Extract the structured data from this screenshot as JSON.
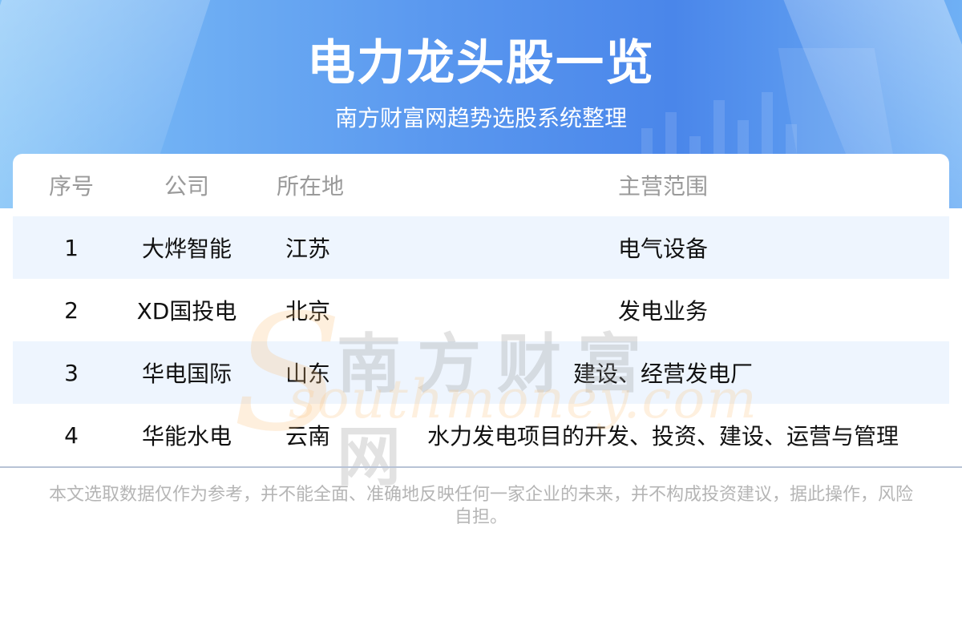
{
  "header": {
    "title": "电力龙头股一览",
    "subtitle": "南方财富网趋势选股系统整理"
  },
  "table": {
    "columns": [
      "序号",
      "公司",
      "所在地",
      "主营范围"
    ],
    "rows": [
      {
        "index": "1",
        "company": "大烨智能",
        "location": "江苏",
        "business": "电气设备"
      },
      {
        "index": "2",
        "company": "XD国投电",
        "location": "北京",
        "business": "发电业务"
      },
      {
        "index": "3",
        "company": "华电国际",
        "location": "山东",
        "business": "建设、经营发电厂"
      },
      {
        "index": "4",
        "company": "华能水电",
        "location": "云南",
        "business": "水力发电项目的开发、投资、建设、运营与管理"
      }
    ]
  },
  "watermark": {
    "cn": "南方财富网",
    "en": "southmoney.com"
  },
  "footer": {
    "disclaimer": "本文选取数据仅作为参考，并不能全面、准确地反映任何一家企业的未来，并不构成投资建议，据此操作，风险自担。"
  },
  "colors": {
    "header_gradient_start": "#7fc1f7",
    "header_gradient_mid": "#4a86ea",
    "row_alt": "#eef5fe",
    "header_text": "#9a9a9a"
  }
}
